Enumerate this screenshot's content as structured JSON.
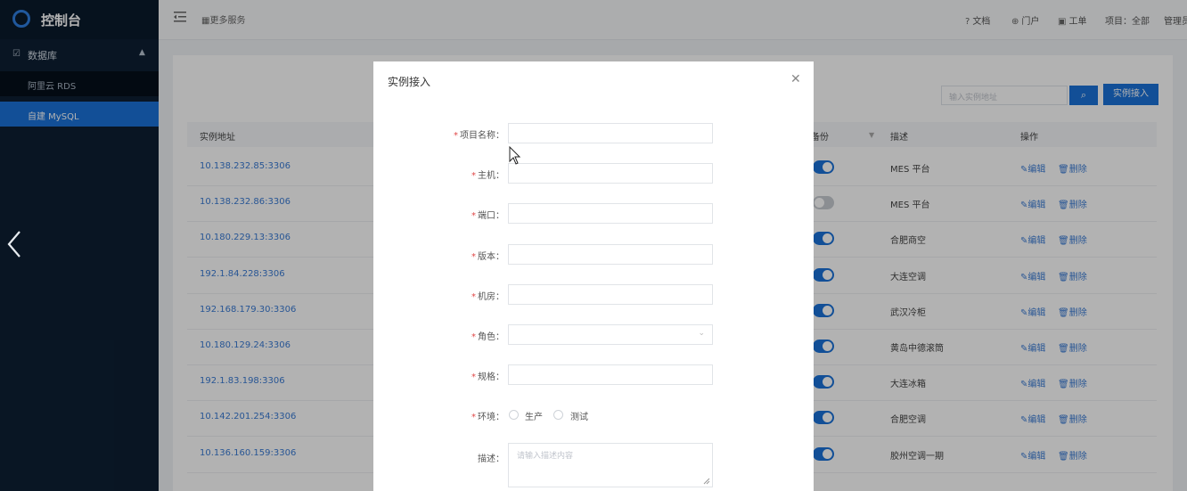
{
  "sidebar": {
    "brand": "控制台",
    "group_label": "数据库",
    "items": [
      {
        "label": "阿里云 RDS",
        "active": false
      },
      {
        "label": "自建 MySQL",
        "active": true
      }
    ]
  },
  "header": {
    "more_services": "更多服务",
    "docs": "文档",
    "portal": "门户",
    "tickets": "工单",
    "project": "项目：全部",
    "admin": "管理员"
  },
  "toolbar": {
    "search_placeholder": "输入实例地址",
    "add_label": "实例接入"
  },
  "table": {
    "headers": {
      "address": "实例地址",
      "backup": "备份",
      "desc": "描述",
      "ops": "操作"
    },
    "edit_label": "编辑",
    "delete_label": "删除",
    "rows": [
      {
        "address": "10.138.232.85:3306",
        "enabled": true,
        "desc": "MES 平台"
      },
      {
        "address": "10.138.232.86:3306",
        "enabled": false,
        "desc": "MES 平台"
      },
      {
        "address": "10.180.229.13:3306",
        "enabled": true,
        "desc": "合肥商空"
      },
      {
        "address": "192.1.84.228:3306",
        "enabled": true,
        "desc": "大连空调"
      },
      {
        "address": "192.168.179.30:3306",
        "enabled": true,
        "desc": "武汉冷柜"
      },
      {
        "address": "10.180.129.24:3306",
        "enabled": true,
        "desc": "黄岛中德滚筒"
      },
      {
        "address": "192.1.83.198:3306",
        "enabled": true,
        "desc": "大连冰箱"
      },
      {
        "address": "10.142.201.254:3306",
        "enabled": true,
        "desc": "合肥空调"
      },
      {
        "address": "10.136.160.159:3306",
        "enabled": true,
        "desc": "胶州空调一期"
      }
    ]
  },
  "modal": {
    "title": "实例接入",
    "fields": [
      {
        "label": "项目名称：",
        "required": true,
        "value": "",
        "type": "text"
      },
      {
        "label": "主机：",
        "required": true,
        "value": "",
        "type": "text"
      },
      {
        "label": "端口：",
        "required": true,
        "value": "",
        "type": "text"
      },
      {
        "label": "版本：",
        "required": true,
        "value": "",
        "type": "text"
      },
      {
        "label": "机房：",
        "required": true,
        "value": "",
        "type": "text"
      },
      {
        "label": "角色：",
        "required": true,
        "value": "",
        "type": "select"
      },
      {
        "label": "规格：",
        "required": true,
        "value": "",
        "type": "text"
      }
    ],
    "env": {
      "label": "环境：",
      "options": [
        "生产",
        "测试"
      ]
    },
    "desc": {
      "label": "描述：",
      "placeholder": "请输入描述内容"
    }
  },
  "colors": {
    "primary": "#1a72d8",
    "sidebar": "#0d1f33",
    "required": "#e04848"
  }
}
